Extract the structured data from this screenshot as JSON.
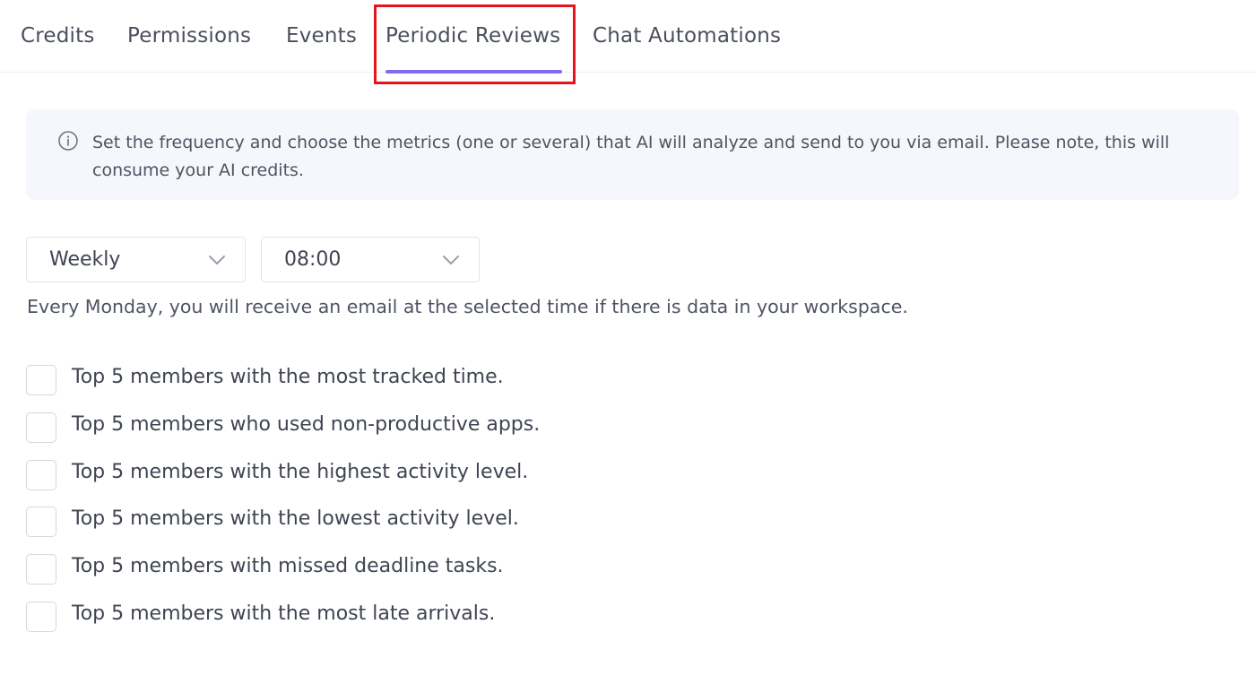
{
  "tabs": [
    {
      "label": "Credits"
    },
    {
      "label": "Permissions"
    },
    {
      "label": "Events"
    },
    {
      "label": "Periodic Reviews",
      "active": true
    },
    {
      "label": "Chat Automations"
    }
  ],
  "info": {
    "icon": "info-circle-icon",
    "text": "Set the frequency and choose the metrics (one or several) that AI will analyze and send to you via email. Please note, this will consume your AI credits."
  },
  "schedule": {
    "frequency": "Weekly",
    "time": "08:00",
    "note": "Every Monday, you will receive an email at the selected time if there is data in your workspace."
  },
  "metrics": [
    {
      "label": "Top 5 members with the most tracked time.",
      "checked": false
    },
    {
      "label": "Top 5 members who used non-productive apps.",
      "checked": false
    },
    {
      "label": "Top 5 members with the highest activity level.",
      "checked": false
    },
    {
      "label": "Top 5 members with the lowest activity level.",
      "checked": false
    },
    {
      "label": "Top 5 members with missed deadline tasks.",
      "checked": false
    },
    {
      "label": "Top 5 members with the most late arrivals.",
      "checked": false
    }
  ],
  "colors": {
    "accent": "#7b6cf0",
    "highlight": "#e8141c",
    "info_background": "#f6f7fc"
  }
}
